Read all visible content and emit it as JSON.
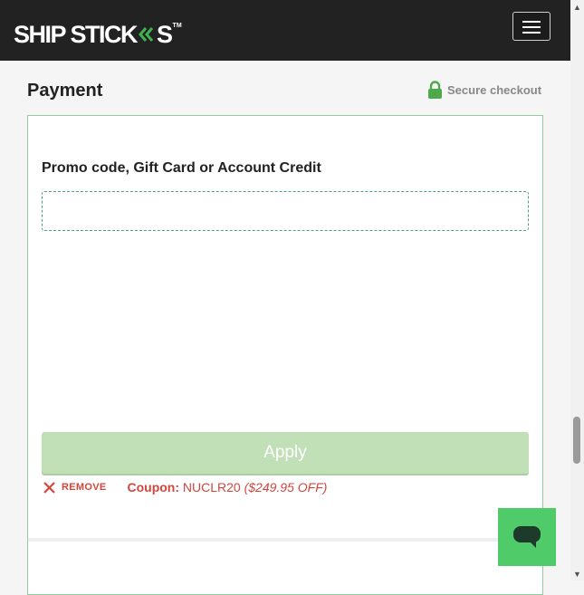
{
  "header": {
    "logo_text_1": "SHIP STICK",
    "logo_text_2": "S",
    "logo_tm": "TM",
    "menu_icon": "hamburger-icon"
  },
  "payment": {
    "title": "Payment",
    "secure_label": "Secure checkout",
    "secure_icon": "lock-icon",
    "accent_color": "#4fa84a"
  },
  "promo": {
    "label": "Promo code, Gift Card or Account Credit",
    "value": "",
    "placeholder": "",
    "apply_label": "Apply",
    "remove_label": "REMOVE",
    "coupon_label": "Coupon:",
    "coupon_code": "NUCLR20",
    "coupon_discount": "($249.95 OFF)",
    "error_color": "#d4453b"
  },
  "chat": {
    "icon": "chat-bubble-icon",
    "color": "#4fcb6a"
  }
}
